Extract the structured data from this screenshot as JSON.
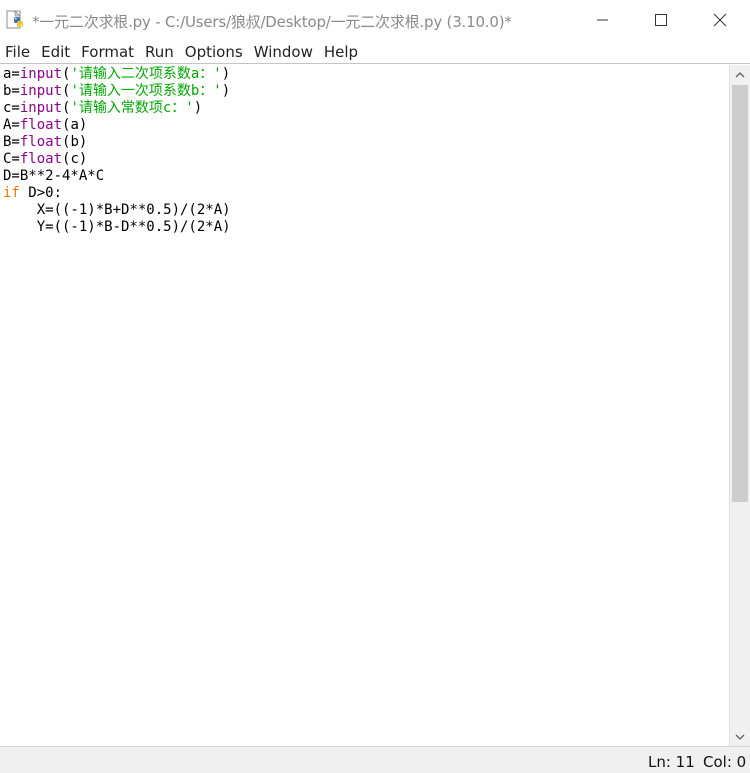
{
  "window": {
    "title": "*一元二次求根.py - C:/Users/狼叔/Desktop/一元二次求根.py (3.10.0)*"
  },
  "menu": {
    "items": [
      "File",
      "Edit",
      "Format",
      "Run",
      "Options",
      "Window",
      "Help"
    ]
  },
  "editor": {
    "lines": [
      [
        {
          "t": "a="
        },
        {
          "t": "input",
          "c": "bi"
        },
        {
          "t": "("
        },
        {
          "t": "'请输入二次项系数a：'",
          "c": "str"
        },
        {
          "t": ")"
        }
      ],
      [
        {
          "t": "b="
        },
        {
          "t": "input",
          "c": "bi"
        },
        {
          "t": "("
        },
        {
          "t": "'请输入一次项系数b：'",
          "c": "str"
        },
        {
          "t": ")"
        }
      ],
      [
        {
          "t": "c="
        },
        {
          "t": "input",
          "c": "bi"
        },
        {
          "t": "("
        },
        {
          "t": "'请输入常数项c：'",
          "c": "str"
        },
        {
          "t": ")"
        }
      ],
      [
        {
          "t": "A="
        },
        {
          "t": "float",
          "c": "bi"
        },
        {
          "t": "(a)"
        }
      ],
      [
        {
          "t": "B="
        },
        {
          "t": "float",
          "c": "bi"
        },
        {
          "t": "(b)"
        }
      ],
      [
        {
          "t": "C="
        },
        {
          "t": "float",
          "c": "bi"
        },
        {
          "t": "(c)"
        }
      ],
      [
        {
          "t": "D=B**2-4*A*C"
        }
      ],
      [
        {
          "t": "if",
          "c": "kw"
        },
        {
          "t": " D>0:"
        }
      ],
      [
        {
          "t": "    X=((-1)*B+D**0.5)/(2*A)"
        }
      ],
      [
        {
          "t": "    Y=((-1)*B-D**0.5)/(2*A)"
        }
      ]
    ]
  },
  "status": {
    "line": "Ln: 11",
    "col": "Col: 0"
  },
  "colors": {
    "keyword": "#ff7700",
    "builtin": "#900090",
    "string": "#00aa00"
  }
}
